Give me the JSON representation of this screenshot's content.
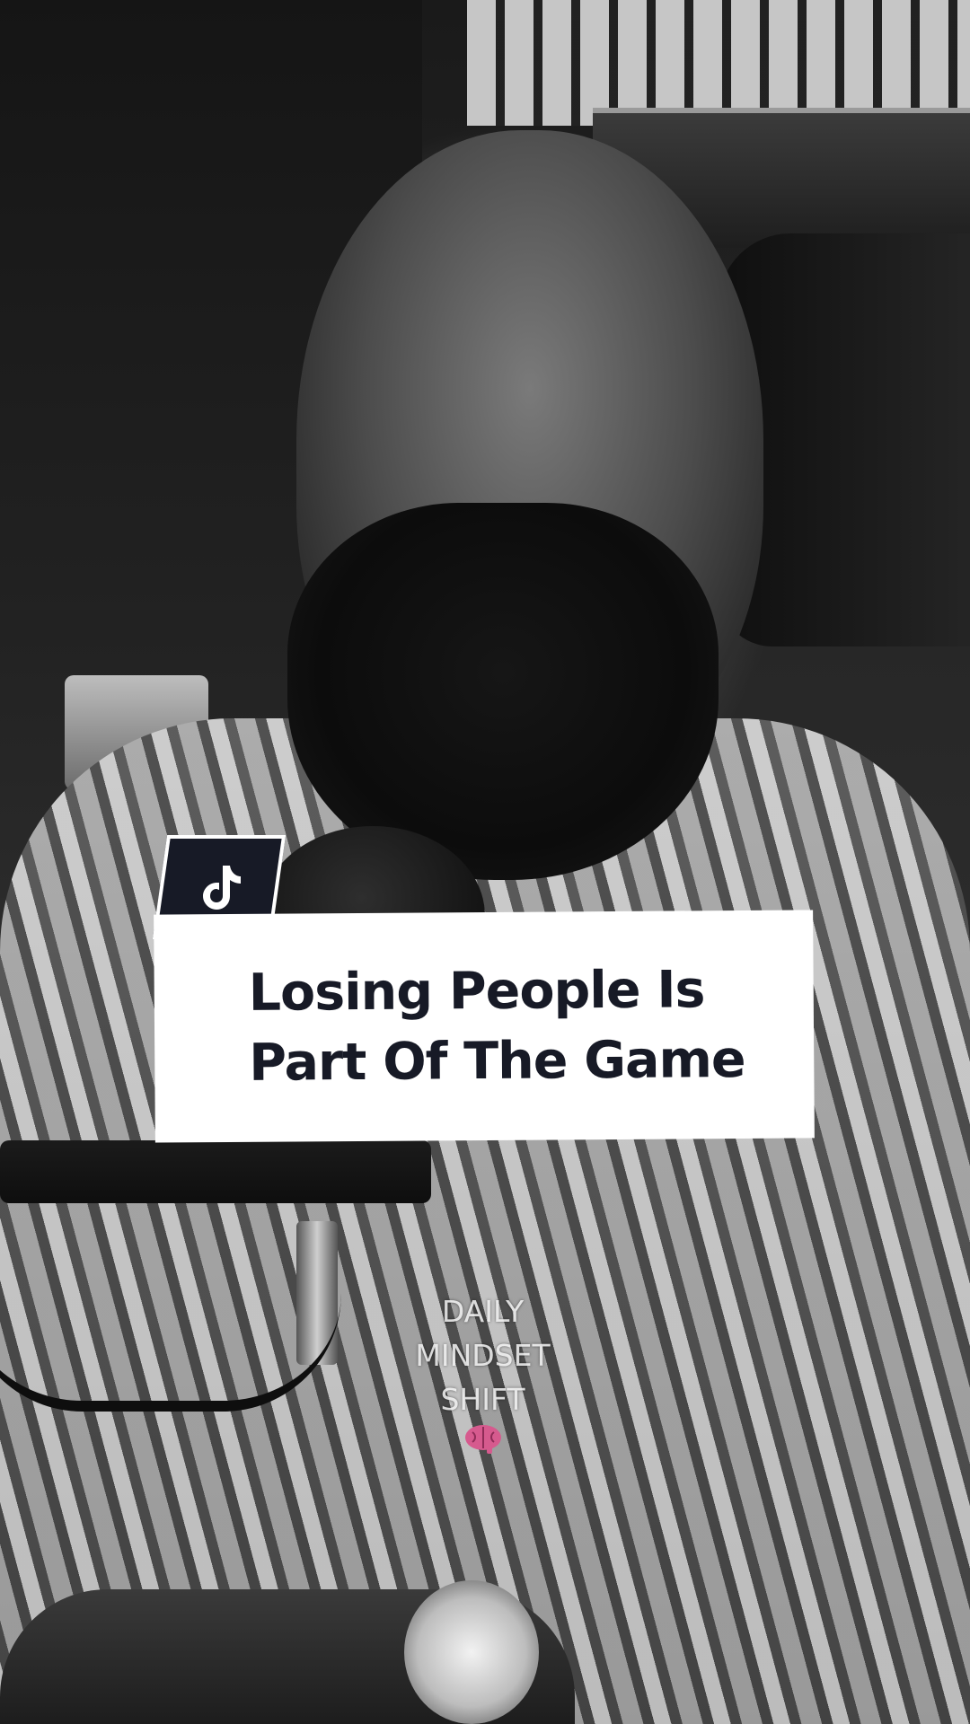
{
  "video": {
    "scene": "black-and-white podcast still",
    "title_lines": [
      "Losing People Is",
      "Part Of The Game"
    ],
    "watermark_lines": [
      "DAILY",
      "MINDSET",
      "SHIFT"
    ],
    "watermark_icon": "brain-icon"
  },
  "badge": {
    "icon": "tiktok-note-icon"
  },
  "colors": {
    "badge_bg": "#171a26",
    "title_text": "#171a26",
    "card_bg": "#ffffff",
    "brain": "#d65a8e"
  }
}
